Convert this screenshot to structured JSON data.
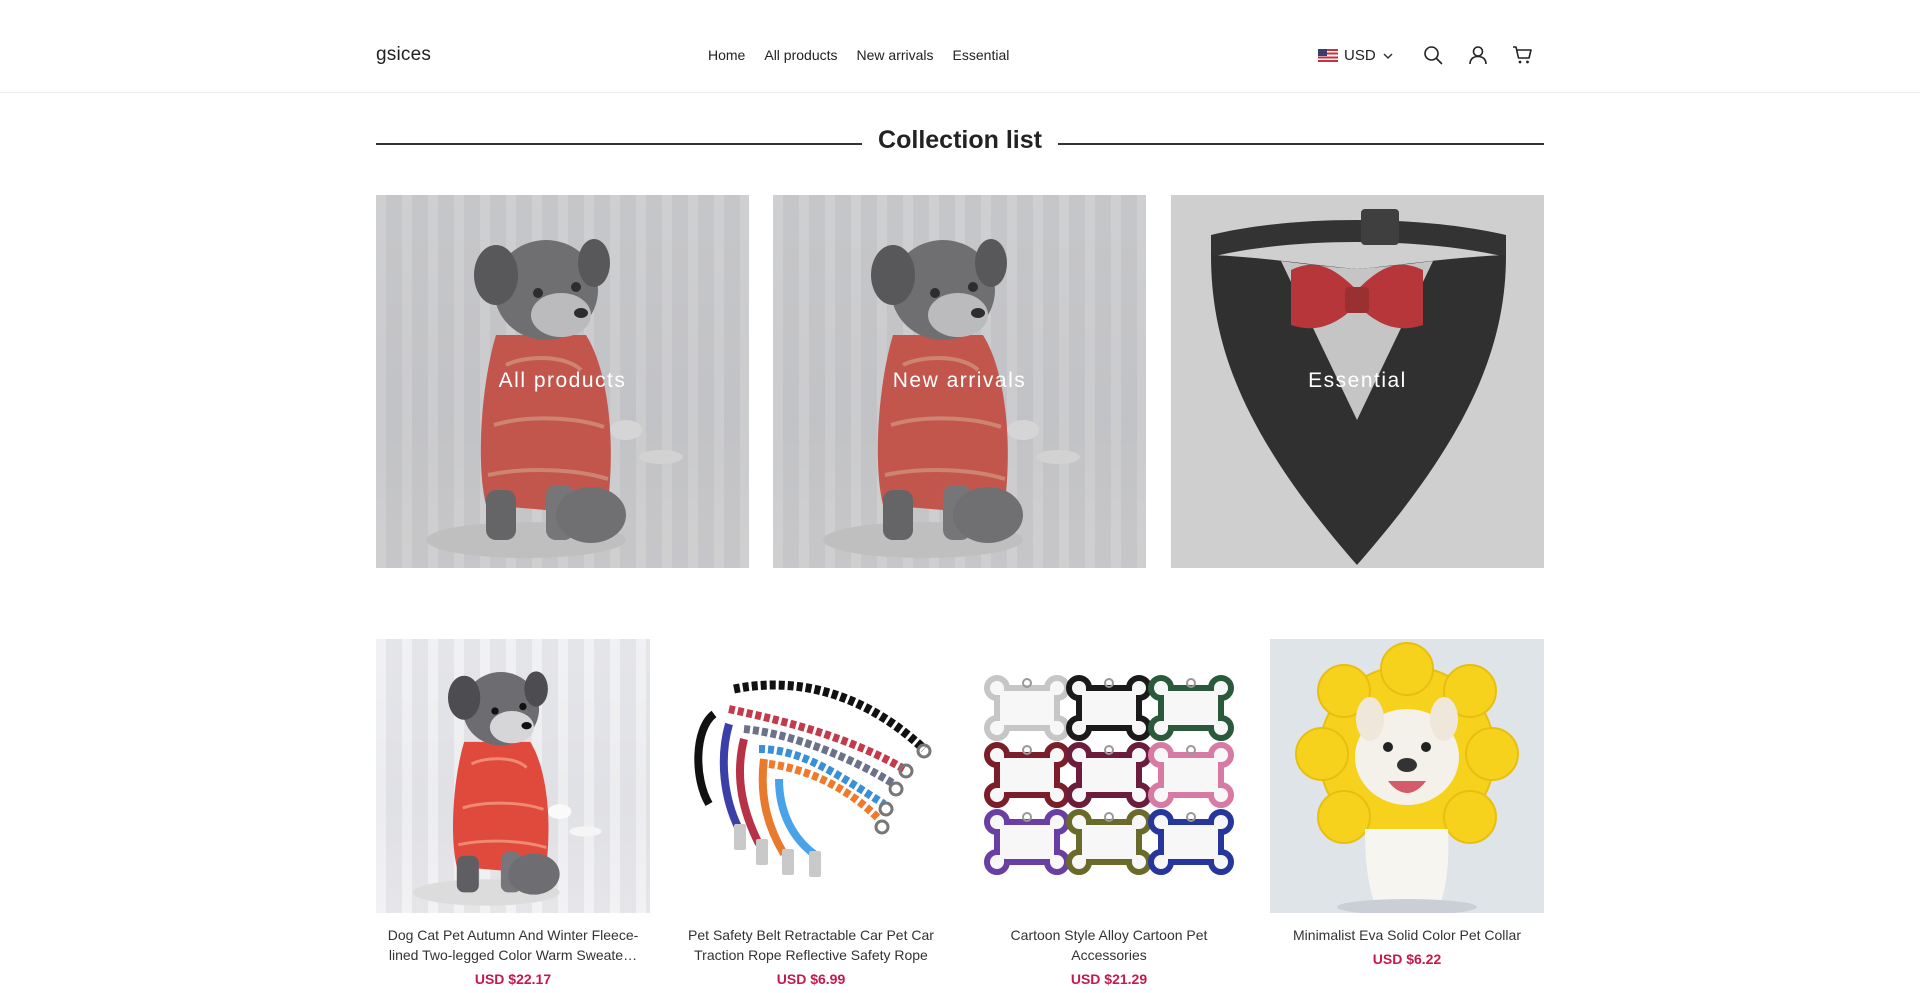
{
  "store": {
    "name": "gsices"
  },
  "nav": {
    "items": [
      {
        "label": "Home"
      },
      {
        "label": "All products"
      },
      {
        "label": "New arrivals"
      },
      {
        "label": "Essential"
      }
    ]
  },
  "header": {
    "currency": "USD",
    "icons": [
      "chevron-down-icon",
      "search-icon",
      "account-icon",
      "cart-icon",
      "us-flag-icon"
    ]
  },
  "collection_list": {
    "title": "Collection list",
    "collections": [
      {
        "label": "All products",
        "image": "dog-red-sweater"
      },
      {
        "label": "New arrivals",
        "image": "dog-red-sweater"
      },
      {
        "label": "Essential",
        "image": "bow-tie-bandana"
      }
    ]
  },
  "products": [
    {
      "title": "Dog Cat Pet Autumn And Winter Fleece-lined Two-legged Color Warm Sweate…",
      "price": "USD $22.17",
      "image": "dog-red-sweater"
    },
    {
      "title": "Pet Safety Belt Retractable Car Pet Car Traction Rope Reflective Safety Rope Do…",
      "price": "USD $6.99",
      "image": "car-safety-leashes"
    },
    {
      "title": "Cartoon Style Alloy Cartoon Pet Accessories",
      "price": "USD $21.29",
      "image": "bone-tags"
    },
    {
      "title": "Minimalist Eva Solid Color Pet Collar",
      "price": "USD $6.22",
      "image": "bulldog-flower-collar"
    }
  ],
  "colors": {
    "price": "#c6194b",
    "sweater": "#e04a3c",
    "accent_text": "#222222"
  }
}
